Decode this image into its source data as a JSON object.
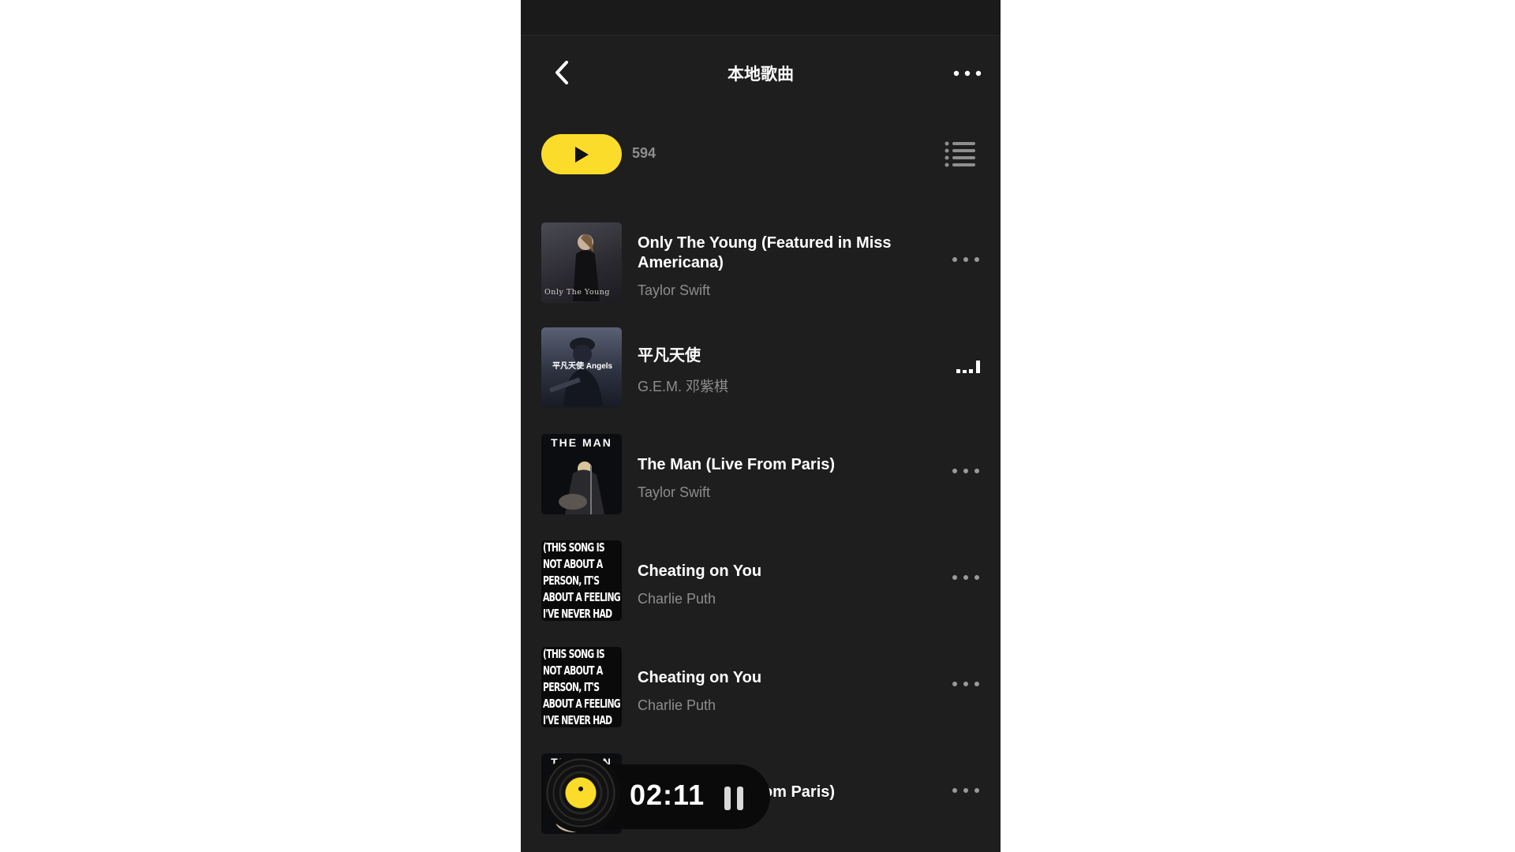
{
  "header": {
    "title": "本地歌曲"
  },
  "toolbar": {
    "song_count": "594"
  },
  "songs": [
    {
      "title": "Only The Young (Featured in Miss Americana)",
      "artist": "Taylor Swift",
      "cover_text": "Only The Young",
      "status": "more"
    },
    {
      "title": "平凡天使",
      "artist": "G.E.M. 邓紫棋",
      "cover_text": "平凡天使 Angels",
      "status": "playing"
    },
    {
      "title": "The Man (Live From Paris)",
      "artist": "Taylor Swift",
      "cover_text": "THE MAN",
      "status": "more"
    },
    {
      "title": "Cheating on You",
      "artist": "Charlie Puth",
      "cover_text": "(THIS SONG IS NOT ABOUT A PERSON, IT'S ABOUT A FEELING I'VE NEVER HAD",
      "status": "more"
    },
    {
      "title": "Cheating on You",
      "artist": "Charlie Puth",
      "cover_text": "(THIS SONG IS NOT ABOUT A PERSON, IT'S ABOUT A FEELING I'VE NEVER HAD",
      "status": "more"
    },
    {
      "title": "The Man (Live From Paris)",
      "artist": "",
      "cover_text": "THE MAN",
      "status": "more"
    }
  ],
  "mini_player": {
    "time": "02:11",
    "state": "playing"
  },
  "colors": {
    "accent": "#fcdc2a",
    "background": "#1e1e1e",
    "text_primary": "#ffffff",
    "text_secondary": "#8d8d8d"
  }
}
